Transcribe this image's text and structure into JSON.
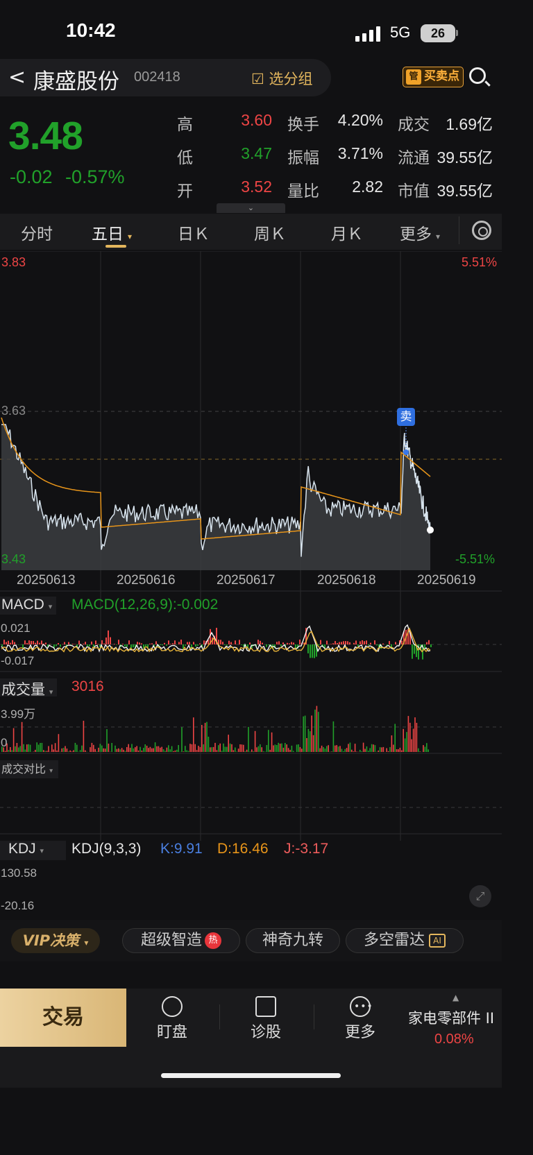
{
  "status": {
    "time": "10:42",
    "network": "5G",
    "battery": "26"
  },
  "header": {
    "back": "<",
    "stock_name": "康盛股份",
    "stock_code": "002418",
    "group_button": "☑ 选分组",
    "bs_button": "买卖点",
    "bs_badge": "管"
  },
  "quote": {
    "price": "3.48",
    "change": "-0.02",
    "change_pct": "-0.57%",
    "rows": [
      {
        "l1": "高",
        "v1": "3.60",
        "l2": "换手",
        "v2": "4.20%",
        "l3": "成交",
        "v3": "1.69亿"
      },
      {
        "l1": "低",
        "v1": "3.47",
        "l2": "振幅",
        "v2": "3.71%",
        "l3": "流通",
        "v3": "39.55亿"
      },
      {
        "l1": "开",
        "v1": "3.52",
        "l2": "量比",
        "v2": "2.82",
        "l3": "市值",
        "v3": "39.55亿"
      }
    ]
  },
  "tabs": [
    "分时",
    "五日",
    "日Ｋ",
    "周Ｋ",
    "月Ｋ",
    "更多"
  ],
  "active_tab": "五日",
  "main_chart": {
    "y_top": "3.83",
    "y_mid": "3.63",
    "y_bottom": "3.43",
    "pct_top": "5.51%",
    "pct_bottom": "-5.51%",
    "sell_marker": "卖",
    "dates": [
      "20250613",
      "20250616",
      "20250617",
      "20250618",
      "20250619"
    ]
  },
  "macd": {
    "title": "MACD",
    "params": "MACD(12,26,9):-0.002",
    "y_top": "0.021",
    "y_bottom": "-0.017"
  },
  "volume": {
    "title": "成交量",
    "value": "3016",
    "y_top": "3.99万",
    "y_bottom": "0"
  },
  "compare": {
    "title": "成交对比"
  },
  "kdj": {
    "title": "KDJ",
    "params": "KDJ(9,3,3)",
    "k": "K:9.91",
    "d": "D:16.46",
    "j": "J:-3.17",
    "y_top": "130.58",
    "y_bottom": "-20.16"
  },
  "features": {
    "vip": "VIP决策",
    "items": [
      "超级智造",
      "神奇九转",
      "多空雷达"
    ],
    "hot": "热",
    "ai": "AI"
  },
  "bottom": {
    "trade": "交易",
    "items": [
      "盯盘",
      "诊股",
      "更多"
    ],
    "sector_name": "家电零部件 II",
    "sector_pct": "0.08%"
  },
  "colors": {
    "up": "#ee4545",
    "down": "#21a12a",
    "avg_line": "#e8951a",
    "price_line": "#d8e4ee",
    "accent": "#e3b65d"
  },
  "chart_data": {
    "type": "line",
    "title": "",
    "x": [
      "20250613",
      "20250616",
      "20250617",
      "20250618",
      "20250619"
    ],
    "ylim": [
      3.43,
      3.83
    ],
    "series": [
      {
        "name": "",
        "values": [
          3.49,
          3.5,
          3.49,
          3.51,
          3.48
        ]
      }
    ]
  }
}
